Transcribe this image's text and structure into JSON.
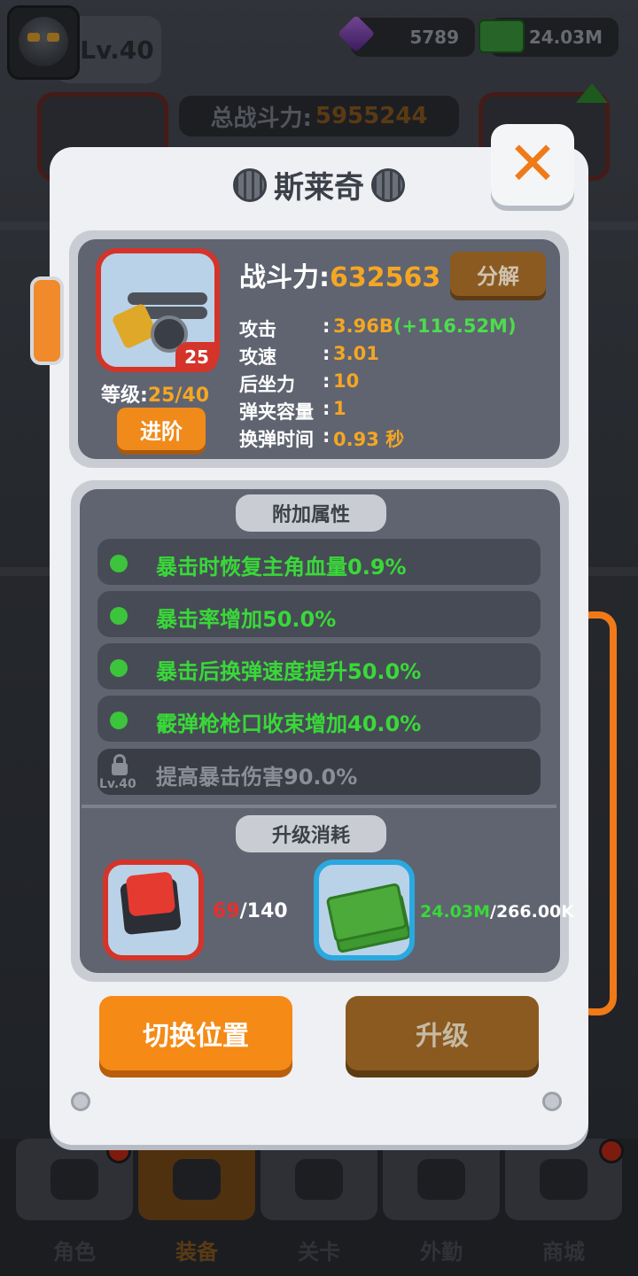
{
  "hud": {
    "player_level": "Lv.40",
    "gems": "5789",
    "cash": "24.03M",
    "total_power_label": "总战斗力:",
    "total_power_value": "5955244"
  },
  "nav": {
    "tabs": [
      {
        "label": "角色",
        "icon": "skull-icon"
      },
      {
        "label": "装备",
        "icon": "gun-icon"
      },
      {
        "label": "关卡",
        "icon": "map-icon"
      },
      {
        "label": "外勤",
        "icon": "bus-icon"
      },
      {
        "label": "商城",
        "icon": "shop-icon"
      }
    ],
    "active_index": 1
  },
  "dialog": {
    "title": "斯莱奇",
    "close_label": "✕",
    "weapon": {
      "level_badge": "25",
      "grade_label": "等级:",
      "grade_value": "25/40",
      "advance_label": "进阶"
    },
    "power_label": "战斗力:",
    "power_value": "632563",
    "decompose_label": "分解",
    "stats": [
      {
        "label": "攻击",
        "value": "3.96B",
        "bonus": "(+116.52M)"
      },
      {
        "label": "攻速",
        "value": "3.01",
        "bonus": ""
      },
      {
        "label": "后坐力",
        "value": "10",
        "bonus": ""
      },
      {
        "label": "弹夹容量",
        "value": "1",
        "bonus": ""
      },
      {
        "label": "换弹时间",
        "value": "0.93 秒",
        "bonus": ""
      }
    ],
    "stat_separator": ":",
    "extra_title": "附加属性",
    "attributes": [
      {
        "text": "暴击时恢复主角血量0.9%"
      },
      {
        "text": "暴击率增加50.0%"
      },
      {
        "text": "暴击后换弹速度提升50.0%"
      },
      {
        "text": "霰弹枪枪口收束增加40.0%"
      }
    ],
    "locked_attribute": {
      "text": "提高暴击伤害90.0%",
      "unlock_level": "Lv.40"
    },
    "cost_title": "升级消耗",
    "costs": [
      {
        "have": "69",
        "need": "/140",
        "item": "chip-icon"
      },
      {
        "have": "24.03M",
        "need": "/266.00K",
        "item": "cash-icon"
      }
    ],
    "switch_label": "切换位置",
    "upgrade_label": "升级"
  },
  "colors": {
    "accent_orange": "#f58a16",
    "value_orange": "#f5a623",
    "attr_green": "#39d839",
    "rarity_red": "#d4342a",
    "rarity_blue": "#2aa8e0"
  }
}
